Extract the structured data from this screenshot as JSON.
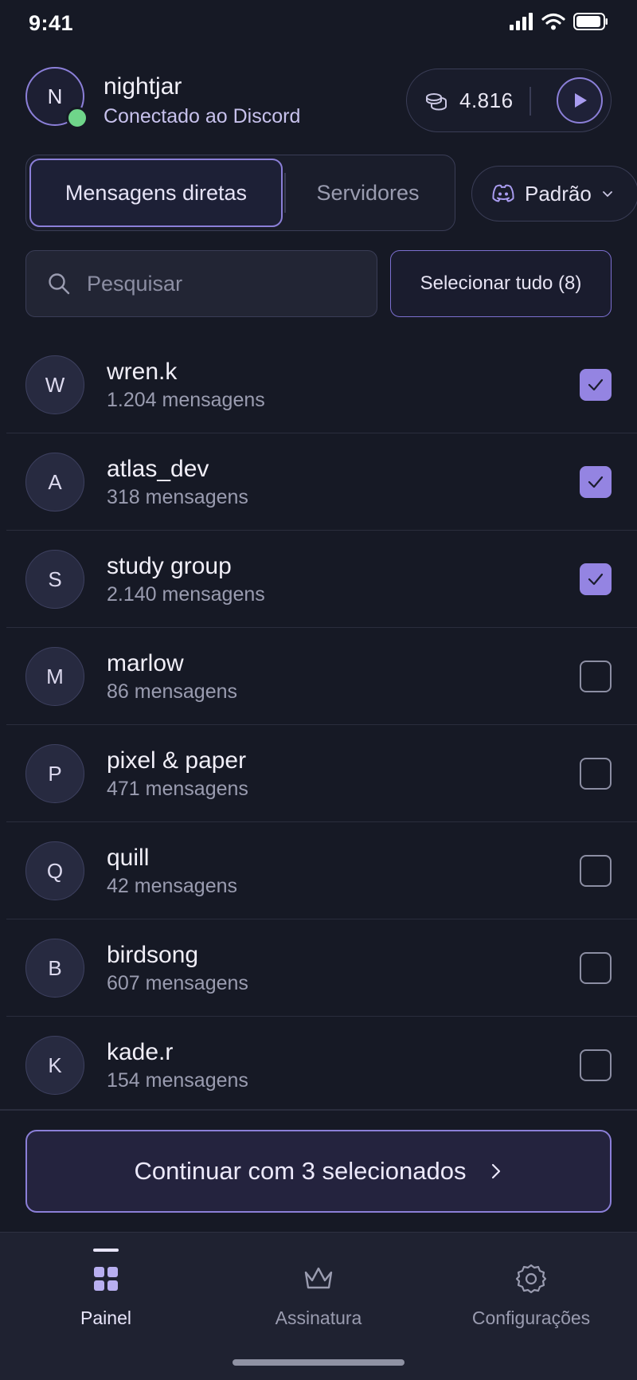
{
  "status_bar": {
    "time": "9:41"
  },
  "user": {
    "initial": "N",
    "name": "nightjar",
    "status": "Conectado ao Discord",
    "online_color": "#6fd58a"
  },
  "credits": {
    "amount": "4.816",
    "icon": "coins-icon",
    "action_icon": "play-icon"
  },
  "tabs": [
    {
      "label": "Mensagens diretas",
      "active": true
    },
    {
      "label": "Servidores",
      "active": false
    }
  ],
  "mode": {
    "label": "Padrão",
    "icon": "discord-icon"
  },
  "search": {
    "placeholder": "Pesquisar",
    "value": ""
  },
  "select_all_label": "Selecionar tudo (8)",
  "conversations": [
    {
      "initial": "W",
      "name": "wren.k",
      "count": "1.204 mensagens",
      "checked": true
    },
    {
      "initial": "A",
      "name": "atlas_dev",
      "count": "318 mensagens",
      "checked": true
    },
    {
      "initial": "S",
      "name": "study group",
      "count": "2.140 mensagens",
      "checked": true
    },
    {
      "initial": "M",
      "name": "marlow",
      "count": "86 mensagens",
      "checked": false
    },
    {
      "initial": "P",
      "name": "pixel & paper",
      "count": "471 mensagens",
      "checked": false
    },
    {
      "initial": "Q",
      "name": "quill",
      "count": "42 mensagens",
      "checked": false
    },
    {
      "initial": "B",
      "name": "birdsong",
      "count": "607 mensagens",
      "checked": false
    },
    {
      "initial": "K",
      "name": "kade.r",
      "count": "154 mensagens",
      "checked": false
    }
  ],
  "continue_label": "Continuar com 3 selecionados",
  "nav": [
    {
      "label": "Painel",
      "icon": "grid-icon",
      "active": true
    },
    {
      "label": "Assinatura",
      "icon": "crown-icon",
      "active": false
    },
    {
      "label": "Configurações",
      "icon": "gear-icon",
      "active": false
    }
  ],
  "colors": {
    "accent": "#8b7fd8",
    "checkbox_checked": "#9484e2",
    "background": "#161925"
  }
}
